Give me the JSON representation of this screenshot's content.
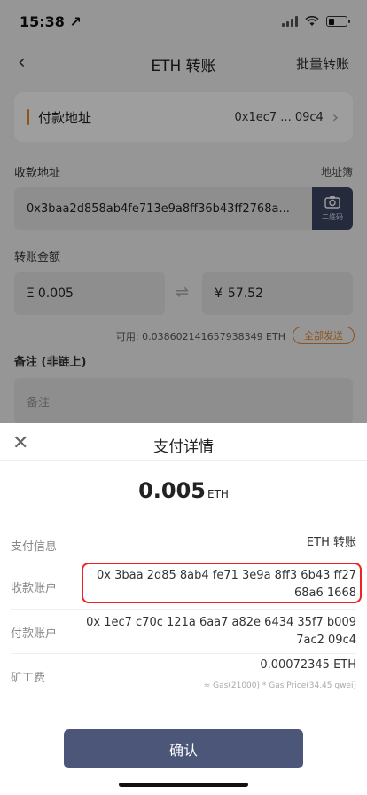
{
  "status": {
    "time": "15:38 ↗"
  },
  "nav": {
    "back": "‹",
    "title": "ETH 转账",
    "right": "批量转账"
  },
  "payer": {
    "label": "付款地址",
    "value": "0x1ec7 ... 09c4",
    "chevron": "›"
  },
  "recipient": {
    "label": "收款地址",
    "address_book": "地址簿",
    "address": "0x3baa2d858ab4fe713e9a8ff36b43ff2768a...",
    "qr_label": "二维码"
  },
  "amount": {
    "label": "转账金额",
    "eth_symbol": "Ξ",
    "eth_value": "0.005",
    "fiat_symbol": "¥",
    "fiat_value": "57.52",
    "available": "可用: 0.038602141657938349 ETH",
    "send_all": "全部发送"
  },
  "memo": {
    "label": "备注 (非链上)",
    "placeholder": "备注"
  },
  "sheet": {
    "close": "✕",
    "title": "支付详情",
    "amount": "0.005",
    "unit": "ETH",
    "rows": [
      {
        "label": "支付信息",
        "value": "ETH 转账"
      },
      {
        "label": "收款账户",
        "value1": "0x 3baa 2d85 8ab4 fe71 3e9a 8ff3 6b43 ff27",
        "value2": "68a6 1668"
      },
      {
        "label": "付款账户",
        "value1": "0x 1ec7 c70c 121a 6aa7 a82e 6434 35f7 b009",
        "value2": "7ac2 09c4"
      },
      {
        "label": "矿工费",
        "value": "0.00072345 ETH",
        "note": "≈ Gas(21000) * Gas Price(34.45 gwei)"
      }
    ],
    "confirm": "确认"
  },
  "colors": {
    "accent": "#e6862f",
    "primary_button": "#4c5679",
    "highlight": "#ee2222"
  }
}
